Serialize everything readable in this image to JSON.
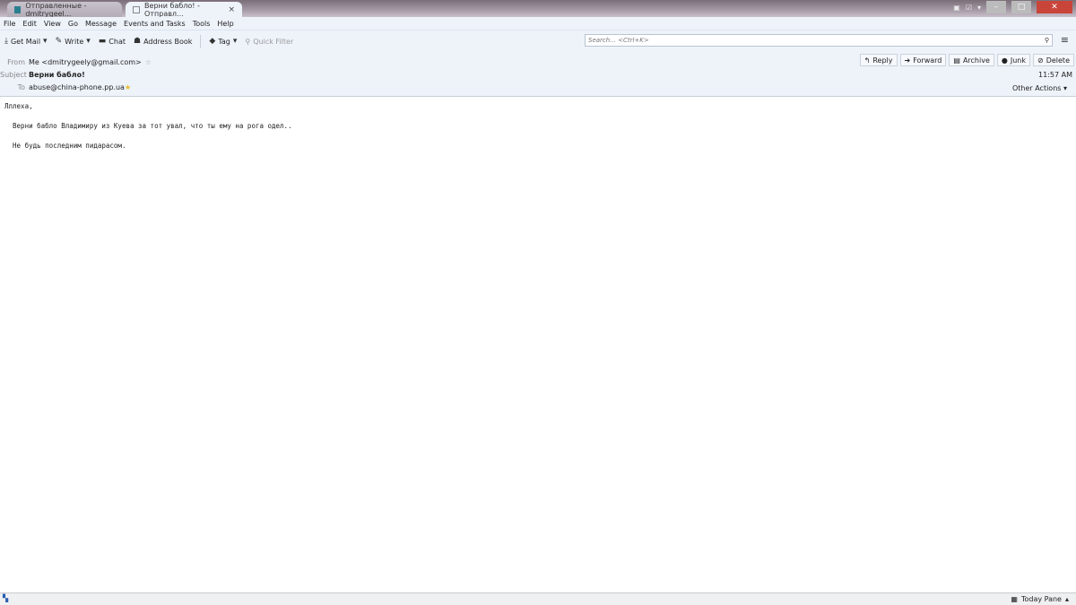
{
  "tabs": [
    {
      "label": "Отправленные - dmitrygeel...",
      "icon": "folder-icon"
    },
    {
      "label": "Верни бабло! - Отправл...",
      "icon": "envelope-icon",
      "close": "×"
    }
  ],
  "menu": [
    "File",
    "Edit",
    "View",
    "Go",
    "Message",
    "Events and Tasks",
    "Tools",
    "Help"
  ],
  "toolbar": {
    "get_mail": "Get Mail",
    "write": "Write",
    "chat": "Chat",
    "address_book": "Address Book",
    "tag": "Tag",
    "quick_filter": "Quick Filter"
  },
  "search": {
    "placeholder": "Search... <Ctrl+K>"
  },
  "message": {
    "from_label": "From",
    "from": "Me <dmitrygeely@gmail.com>",
    "subject_label": "Subject",
    "subject": "Верни бабло!",
    "to_label": "To",
    "to": "abuse@china-phone.pp.ua",
    "time": "11:57 AM",
    "actions": {
      "reply": "Reply",
      "forward": "Forward",
      "archive": "Archive",
      "junk": "Junk",
      "delete": "Delete",
      "other": "Other Actions"
    },
    "body": [
      "Лллеха,",
      "  Верни бабло Владимиру из Куева за тот увал, что ты ему на рога одел..",
      "  Не будь последним пидарасом."
    ]
  },
  "status": {
    "today_pane": "Today Pane"
  }
}
